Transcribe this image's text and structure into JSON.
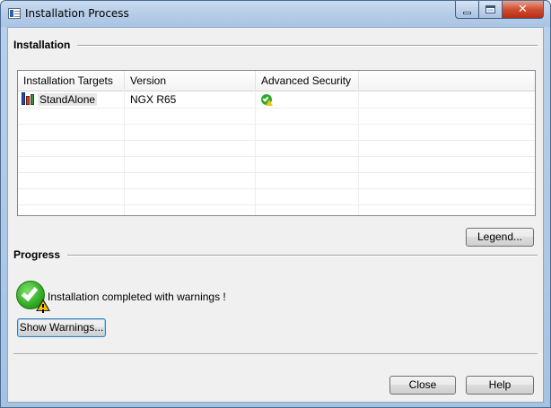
{
  "window": {
    "title": "Installation Process",
    "icon": "app-window-icon"
  },
  "installation": {
    "section_title": "Installation",
    "columns": [
      "Installation Targets",
      "Version",
      "Advanced Security",
      ""
    ],
    "rows": [
      {
        "target": "StandAlone",
        "target_icon": "gateway-icon",
        "version": "NGX R65",
        "security_icon": "check-warning-icon"
      }
    ]
  },
  "legend_button": "Legend...",
  "progress": {
    "section_title": "Progress",
    "status_icon": "success-with-warnings-icon",
    "status_text": "Installation completed with warnings !"
  },
  "show_warnings_button": "Show Warnings...",
  "footer": {
    "close_label": "Close",
    "help_label": "Help"
  }
}
